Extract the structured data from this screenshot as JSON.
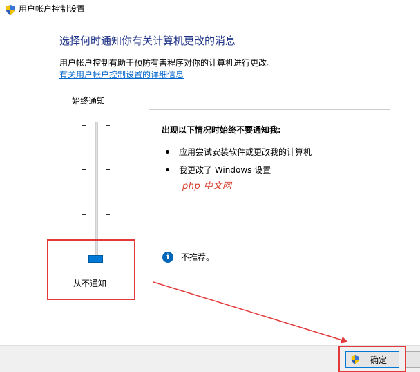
{
  "window": {
    "title": "用户帐户控制设置",
    "icon": "uac-shield-icon"
  },
  "main": {
    "heading": "选择何时通知你有关计算机更改的消息",
    "description": "用户帐户控制有助于预防有害程序对你的计算机进行更改。",
    "link_text": "有关用户帐户控制设置的详细信息"
  },
  "slider": {
    "top_label": "始终通知",
    "bottom_label": "从不通知",
    "levels": 4,
    "selected_level": 1
  },
  "info_box": {
    "title": "出现以下情况时始终不要通知我:",
    "bullets": [
      "应用尝试安装软件或更改我的计算机",
      "我更改了 Windows 设置"
    ],
    "watermark": "php 中文网",
    "note": "不推荐。"
  },
  "footer": {
    "ok_label": "确定"
  },
  "colors": {
    "heading": "#1e3287",
    "link": "#0066cc",
    "accent": "#0078d7",
    "annotation": "#e23a3a"
  }
}
